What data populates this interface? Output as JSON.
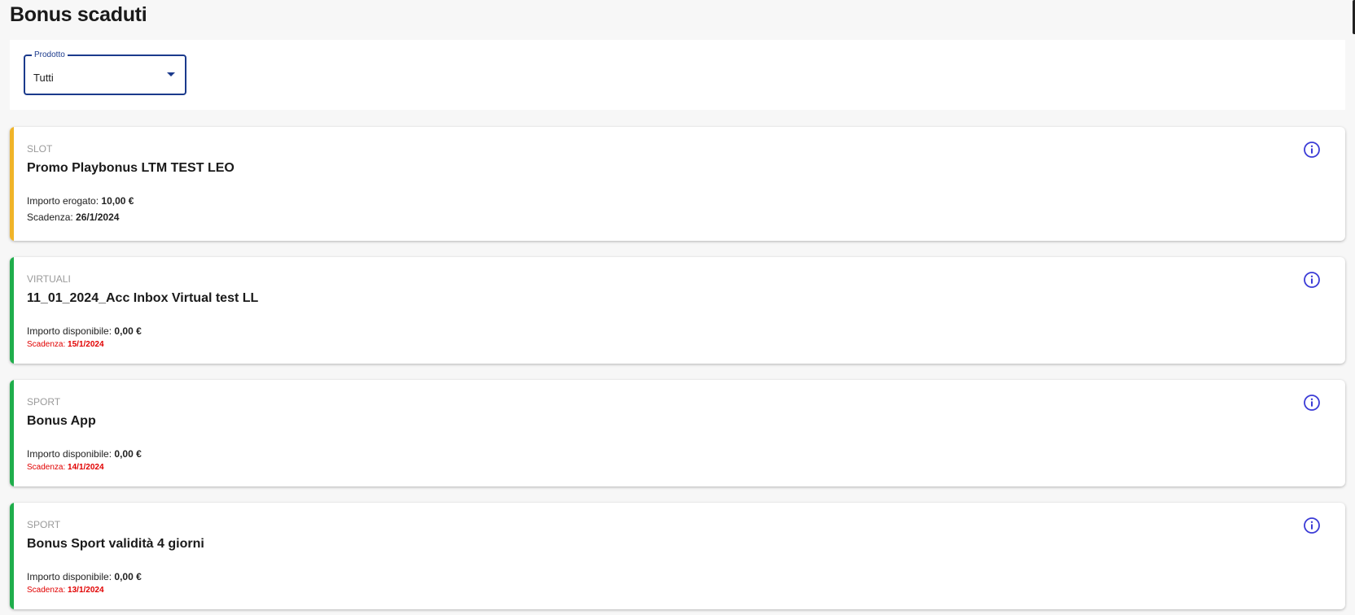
{
  "page": {
    "title": "Bonus scaduti"
  },
  "filter": {
    "label": "Prodotto",
    "value": "Tutti",
    "accent": "#1b3a8c"
  },
  "cards": [
    {
      "category": "SLOT",
      "name": "Promo Playbonus LTM TEST LEO",
      "amount_label": "Importo erogato",
      "amount_value": "10,00 €",
      "expiry_label": "Scadenza",
      "expiry_value": "26/1/2024",
      "expired_style": false,
      "accent": "#f0b429",
      "icon": "info-icon"
    },
    {
      "category": "VIRTUALI",
      "name": "11_01_2024_Acc Inbox Virtual test LL",
      "amount_label": "Importo disponibile",
      "amount_value": "0,00 €",
      "expiry_label": "Scadenza",
      "expiry_value": "15/1/2024",
      "expired_style": true,
      "accent": "#1fae4b",
      "icon": "info-icon"
    },
    {
      "category": "SPORT",
      "name": "Bonus App",
      "amount_label": "Importo disponibile",
      "amount_value": "0,00 €",
      "expiry_label": "Scadenza",
      "expiry_value": "14/1/2024",
      "expired_style": true,
      "accent": "#1fae4b",
      "icon": "info-icon"
    },
    {
      "category": "SPORT",
      "name": "Bonus Sport validità 4 giorni",
      "amount_label": "Importo disponibile",
      "amount_value": "0,00 €",
      "expiry_label": "Scadenza",
      "expiry_value": "13/1/2024",
      "expired_style": true,
      "accent": "#1fae4b",
      "icon": "info-icon"
    }
  ],
  "colors": {
    "info_icon": "#3b3bd6",
    "expired_text": "#e10000"
  }
}
